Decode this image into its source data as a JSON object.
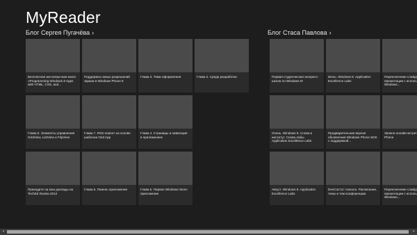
{
  "app": {
    "title": "MyReader"
  },
  "groups": [
    {
      "header": "Блог Сергея Пугачёва",
      "items": [
        "Бесплатная англоязычная книга «Programming Windows 8 Apps with HTML, CSS, and...",
        "Поддержка новых разрешений экрана в Windows Phone 8",
        "Глава 3. Тема оформления",
        "Глава 2. Среда разработки",
        "Глава 8. Элементы управления GridView, ListView и FlipView",
        "Глава 7. RSS-клиент на основе шаблона Grid App",
        "Глава 4. Страницы и навигация в приложениях",
        "Приходите на мои доклады на TechEd Russia 2012",
        "Глава 6. Панель приложения",
        "Глава 5. Первое Windows Store-приложение"
      ]
    },
    {
      "header": "Блог Стаса Павлова",
      "items": [
        "Первая студенческая экспресс-школа по Windows 8!",
        "Июль. Windows 8. Application Excellence Labs",
        "Переключение слайдов в презентации с использованием Windows...",
        "Осень. Windows 8. Снова в институт. Снова лабы. Application Excellence Labs",
        "Предварительная версия обновления Windows Phone SDK с поддержкой...",
        "Записи онлайн-встреч Windows Phone",
        "Август. Windows 8. Application Excellence Labs",
        "DevCon'12: Начало. Расписание, темы и тем конференции.",
        "Переключение слайдов в презентации с использованием Windows..."
      ]
    }
  ],
  "chevron": "›",
  "scrollbar": {
    "left_arrow": "◂",
    "right_arrow": "▸"
  }
}
